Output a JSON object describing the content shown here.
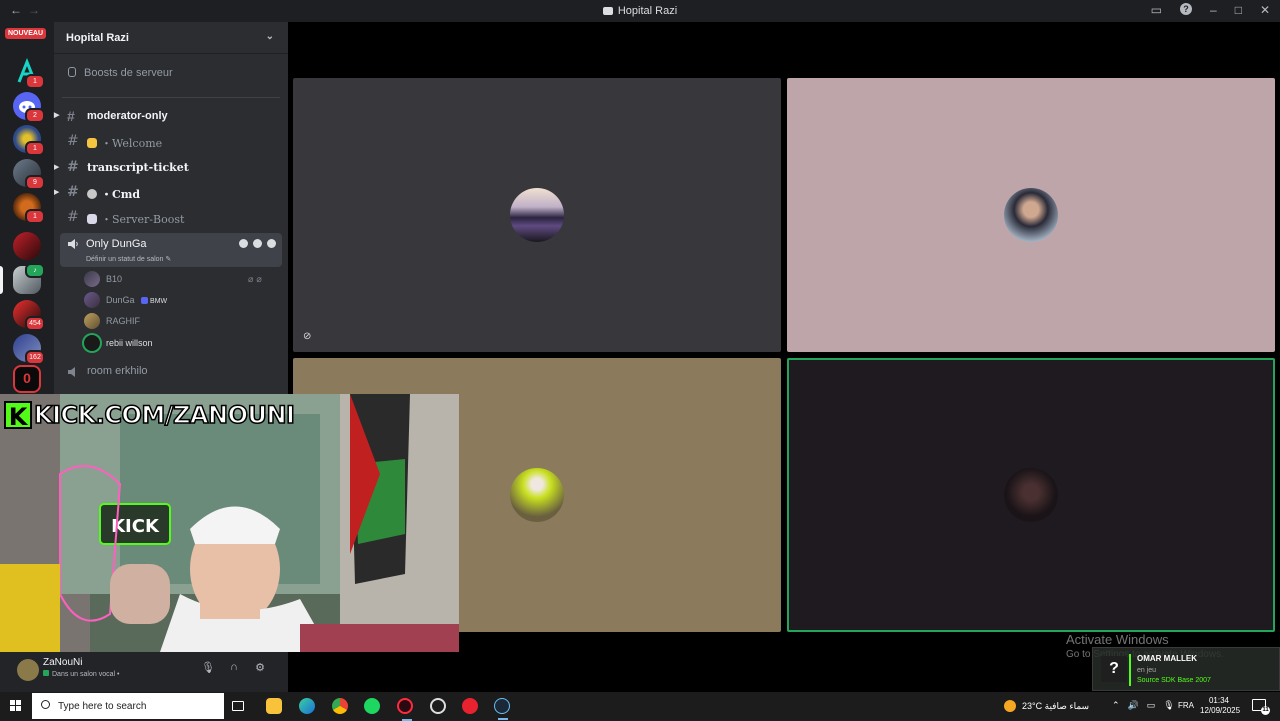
{
  "window": {
    "title": "Hopital Razi"
  },
  "server_rail": {
    "new_label": "NOUVEAU",
    "servers": [
      {
        "name": "server-nouveau",
        "badge": "1"
      },
      {
        "name": "server-a",
        "badge": "1"
      },
      {
        "name": "server-discord",
        "badge": "2"
      },
      {
        "name": "server-4",
        "badge": "1"
      },
      {
        "name": "server-5",
        "badge": "9"
      },
      {
        "name": "server-6",
        "badge": "1"
      },
      {
        "name": "server-7",
        "badge": ""
      },
      {
        "name": "server-hopital-razi",
        "badge": ""
      },
      {
        "name": "server-9",
        "badge": "454"
      },
      {
        "name": "server-10",
        "badge": "162"
      },
      {
        "name": "server-11",
        "badge": ""
      }
    ]
  },
  "sidebar": {
    "guild_name": "Hopital Razi",
    "boosts_label": "Boosts de serveur",
    "channels": [
      {
        "label": "moderator-only",
        "bold": true
      },
      {
        "label": "・Welcome",
        "bold": false
      },
      {
        "label": "transcript-ticket",
        "bold": true
      },
      {
        "label": "・Cmd",
        "bold": true
      },
      {
        "label": "・Server-Boost",
        "bold": false
      }
    ],
    "active_voice": {
      "name": "Only DunGa",
      "status_hint": "Définir un statut de salon"
    },
    "members": [
      {
        "name": "B10",
        "tag": ""
      },
      {
        "name": "DunGa",
        "tag": "BMW"
      },
      {
        "name": "RAGHIF",
        "tag": ""
      },
      {
        "name": "rebii willson",
        "tag": ""
      }
    ],
    "other_voice": {
      "name": "room erkhilo"
    }
  },
  "userbar": {
    "username": "ZaNouNi",
    "status": "Dans un salon vocal •"
  },
  "stream_overlay": {
    "logo_letter": "K",
    "url_text": "KICK.COM/ZANOUNI"
  },
  "watermark": {
    "line1": "Activate Windows",
    "line2": "Go to Settings to activate Windows."
  },
  "game_notification": {
    "user": "OMAR MALLEK",
    "state": "en jeu",
    "game": "Source SDK Base 2007"
  },
  "taskbar": {
    "search_placeholder": "Type here to search",
    "weather": "23°C  سماء صافية",
    "language": "FRA",
    "time": "01:34",
    "date": "12/09/2025",
    "notif_count": "11"
  },
  "colors": {
    "accent_green": "#23a55a",
    "kick_green": "#53fc18",
    "tile_grey": "#38383c",
    "tile_pink": "#bea5aa",
    "tile_tan": "#8b7a5c",
    "tile_dark": "#1e1a20"
  }
}
